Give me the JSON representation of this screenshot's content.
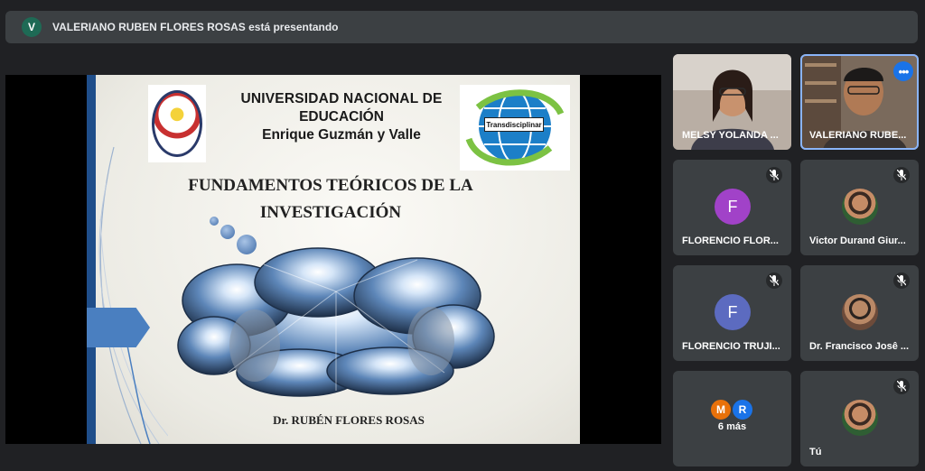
{
  "presenter_bar": {
    "avatar_letter": "V",
    "text": "VALERIANO RUBEN FLORES ROSAS está presentando"
  },
  "slide": {
    "university_line1": "UNIVERSIDAD NACIONAL DE",
    "university_line2": "EDUCACIÓN",
    "university_line3": "Enrique Guzmán y Valle",
    "globe_label": "Transdisciplinar",
    "title_line1": "FUNDAMENTOS TEÓRICOS DE LA",
    "title_line2": "INVESTIGACIÓN",
    "author": "Dr. RUBÉN FLORES ROSAS"
  },
  "participants": [
    {
      "name": "MELSY YOLANDA ...",
      "type": "video"
    },
    {
      "name": "VALERIANO RUBE...",
      "type": "video",
      "more_label": "•••"
    },
    {
      "name": "FLORENCIO FLOR...",
      "avatar_letter": "F",
      "avatar_color": "#a142c8",
      "muted": true
    },
    {
      "name": "Victor Durand Giur...",
      "type": "photo",
      "muted": true
    },
    {
      "name": "FLORENCIO TRUJI...",
      "avatar_letter": "F",
      "avatar_color": "#5c6bc0",
      "muted": true
    },
    {
      "name": "Dr. Francisco Josê ...",
      "type": "photo",
      "muted": true
    },
    {
      "name": "6 más",
      "mini_avatars": [
        {
          "letter": "M",
          "color": "#e8710a"
        },
        {
          "letter": "R",
          "color": "#1a73e8"
        }
      ]
    },
    {
      "name": "Tú",
      "type": "photo",
      "muted": true
    }
  ]
}
